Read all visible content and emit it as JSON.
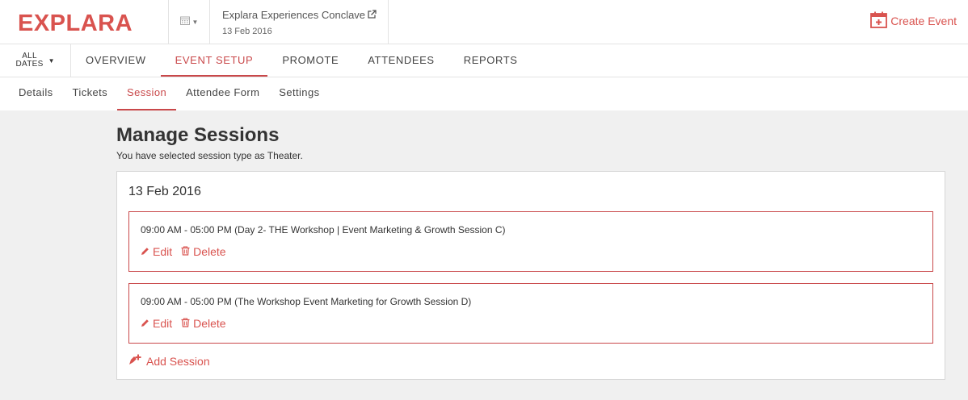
{
  "header": {
    "logo_text": "EXPLARA",
    "event_title": "Explara Experiences Conclave",
    "event_date": "13 Feb 2016",
    "create_event_label": "Create Event"
  },
  "main_nav": {
    "all_dates_line1": "ALL",
    "all_dates_line2": "DATES",
    "tabs": [
      {
        "label": "OVERVIEW",
        "active": false
      },
      {
        "label": "EVENT SETUP",
        "active": true
      },
      {
        "label": "PROMOTE",
        "active": false
      },
      {
        "label": "ATTENDEES",
        "active": false
      },
      {
        "label": "REPORTS",
        "active": false
      }
    ]
  },
  "sub_nav": {
    "tabs": [
      {
        "label": "Details",
        "active": false
      },
      {
        "label": "Tickets",
        "active": false
      },
      {
        "label": "Session",
        "active": true
      },
      {
        "label": "Attendee Form",
        "active": false
      },
      {
        "label": "Settings",
        "active": false
      }
    ]
  },
  "content": {
    "title": "Manage Sessions",
    "subtitle": "You have selected session type as Theater.",
    "date_heading": "13 Feb 2016",
    "sessions": [
      {
        "text": "09:00 AM - 05:00 PM (Day 2- THE Workshop | Event Marketing & Growth Session C)",
        "edit_label": "Edit",
        "delete_label": "Delete"
      },
      {
        "text": "09:00 AM - 05:00 PM (The Workshop Event Marketing for Growth Session D)",
        "edit_label": "Edit",
        "delete_label": "Delete"
      }
    ],
    "add_session_label": "Add Session"
  },
  "colors": {
    "accent": "#c9484a",
    "link": "#d9534f"
  }
}
